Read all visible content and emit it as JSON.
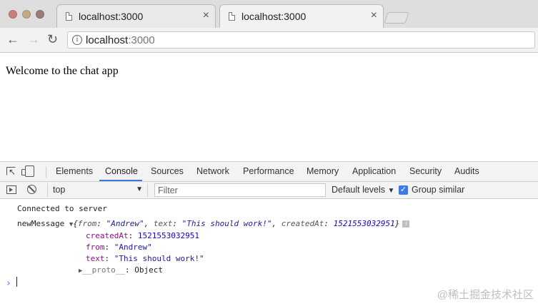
{
  "browser": {
    "tabs": [
      {
        "title": "localhost:3000",
        "active": false
      },
      {
        "title": "localhost:3000",
        "active": true
      }
    ],
    "tab_close_glyph": "×",
    "address": {
      "host": "localhost",
      "port": ":3000"
    }
  },
  "page": {
    "text": "Welcome to the chat app"
  },
  "devtools": {
    "tabs": [
      "Elements",
      "Console",
      "Sources",
      "Network",
      "Performance",
      "Memory",
      "Application",
      "Security",
      "Audits"
    ],
    "active_tab": "Console",
    "console_toolbar": {
      "context": "top",
      "filter_placeholder": "Filter",
      "levels": "Default levels",
      "group_similar": "Group similar",
      "group_similar_checked": true
    },
    "console": {
      "line1": "Connected to server",
      "msg_label": "newMessage",
      "summary_open": "{",
      "k_from": "from",
      "v_from": "\"Andrew\"",
      "k_text": "text",
      "v_text": "\"This should work!\"",
      "k_created": "createdAt",
      "v_created": "1521553032951",
      "summary_close": "}",
      "info_badge": "i",
      "proto_key": "__proto__",
      "proto_val": "Object"
    },
    "prompt": "›"
  },
  "watermark": "@稀土掘金技术社区",
  "colors": {
    "accent": "#3b7ae4",
    "string": "#1a1aa6",
    "number": "#1c00cf",
    "key": "#881280"
  }
}
